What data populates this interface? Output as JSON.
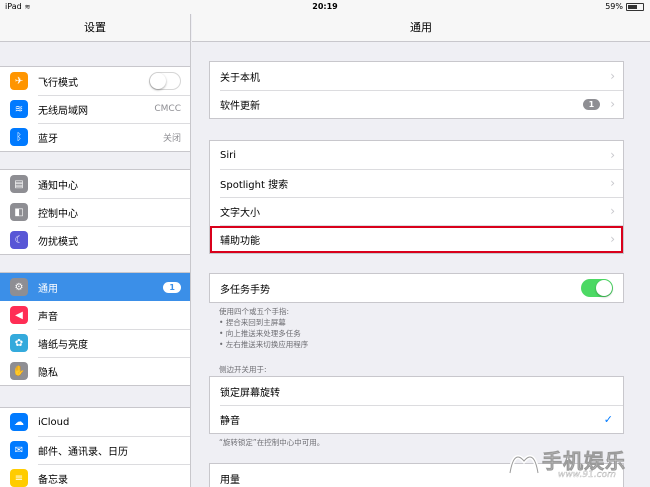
{
  "status_bar": {
    "device": "iPad",
    "time": "20:19",
    "battery_percent": "59%",
    "battery_level": 0.59
  },
  "sidebar": {
    "title": "设置",
    "groups": [
      [
        {
          "label": "飞行模式",
          "icon": "airplane-icon",
          "color": "#ff9500",
          "toggle": "off"
        },
        {
          "label": "无线局域网",
          "icon": "wifi-icon",
          "color": "#007aff",
          "value": "CMCC"
        },
        {
          "label": "蓝牙",
          "icon": "bluetooth-icon",
          "color": "#007aff",
          "value": "关闭"
        }
      ],
      [
        {
          "label": "通知中心",
          "icon": "notification-center-icon",
          "color": "#8e8e93"
        },
        {
          "label": "控制中心",
          "icon": "control-center-icon",
          "color": "#8e8e93"
        },
        {
          "label": "勿扰模式",
          "icon": "moon-icon",
          "color": "#5856d6"
        }
      ],
      [
        {
          "label": "通用",
          "icon": "gear-icon",
          "color": "#8e8e93",
          "badge": "1",
          "selected": true
        },
        {
          "label": "声音",
          "icon": "speaker-icon",
          "color": "#ff2d55"
        },
        {
          "label": "墙纸与亮度",
          "icon": "wallpaper-icon",
          "color": "#34aadc"
        },
        {
          "label": "隐私",
          "icon": "hand-icon",
          "color": "#8e8e93"
        }
      ],
      [
        {
          "label": "iCloud",
          "icon": "cloud-icon",
          "color": "#007aff"
        },
        {
          "label": "邮件、通讯录、日历",
          "icon": "mail-icon",
          "color": "#007aff"
        },
        {
          "label": "备忘录",
          "icon": "notes-icon",
          "color": "#ffcc00"
        }
      ]
    ]
  },
  "detail": {
    "title": "通用",
    "group1": [
      {
        "label": "关于本机"
      },
      {
        "label": "软件更新",
        "badge": "1"
      }
    ],
    "group2": [
      {
        "label": "Siri"
      },
      {
        "label": "Spotlight 搜索"
      },
      {
        "label": "文字大小"
      },
      {
        "label": "辅助功能",
        "highlighted": true
      }
    ],
    "multitask": {
      "label": "多任务手势",
      "toggle": "on"
    },
    "multitask_notes": [
      "使用四个或五个手指:",
      "• 捏合来回到主屏幕",
      "• 向上推送来处理多任务",
      "• 左右推送来切换应用程序"
    ],
    "side_switch_header": "侧边开关用于:",
    "side_switch_options": [
      {
        "label": "锁定屏幕旋转",
        "checked": false
      },
      {
        "label": "静音",
        "checked": true
      }
    ],
    "side_switch_note": "“旋转锁定”在控制中心中可用。",
    "usage_label": "用量"
  },
  "watermark": {
    "brand": "手机娱乐",
    "url": "www.91.com"
  },
  "colors": {
    "selected": "#3b8fe8",
    "toggle_on": "#4cd964",
    "highlight_border": "#d9001b"
  }
}
